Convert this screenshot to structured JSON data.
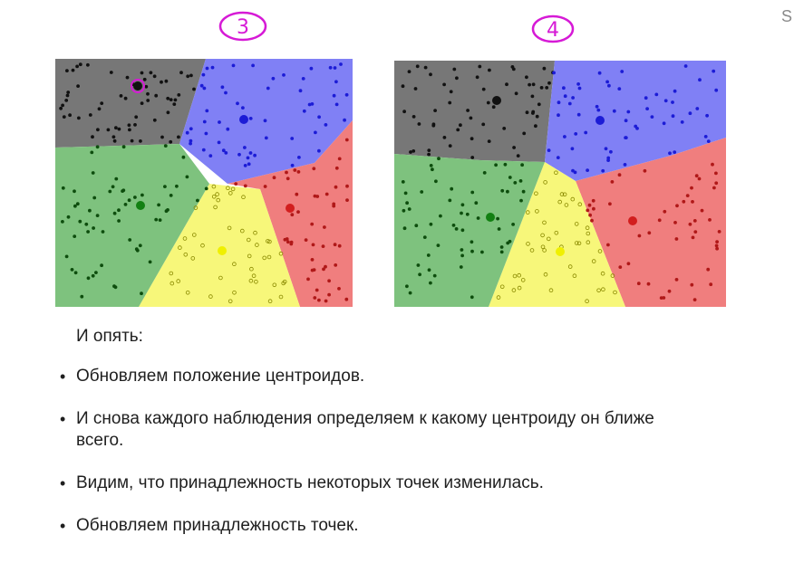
{
  "diagram": {
    "panels": [
      {
        "step_label": "3",
        "label_color": "#d61ad6",
        "region_colors": {
          "black": "#777777",
          "blue": "#8080f5",
          "red": "#f07e7e",
          "yellow": "#f7f77a",
          "green": "#7ec27e"
        },
        "centroid_colors": {
          "black": "#111111",
          "blue": "#1c1cd6",
          "red": "#d21e1e",
          "yellow": "#f0f000",
          "green": "#128012"
        },
        "highlight_color": "#d61ad6"
      },
      {
        "step_label": "4",
        "label_color": "#d61ad6",
        "region_colors": {
          "black": "#777777",
          "blue": "#8080f5",
          "red": "#f07e7e",
          "yellow": "#f7f77a",
          "green": "#7ec27e"
        },
        "centroid_colors": {
          "black": "#111111",
          "blue": "#1c1cd6",
          "red": "#d21e1e",
          "yellow": "#f0f000",
          "green": "#128012"
        }
      }
    ]
  },
  "text": {
    "intro": "И опять:",
    "bullets": [
      "Обновляем положение центроидов.",
      "И снова каждого наблюдения определяем к какому центроиду он ближе всего.",
      "Видим, что принадлежность некоторых точек изменилась.",
      "Обновляем принадлежность точек."
    ]
  },
  "edge_mark": "S"
}
